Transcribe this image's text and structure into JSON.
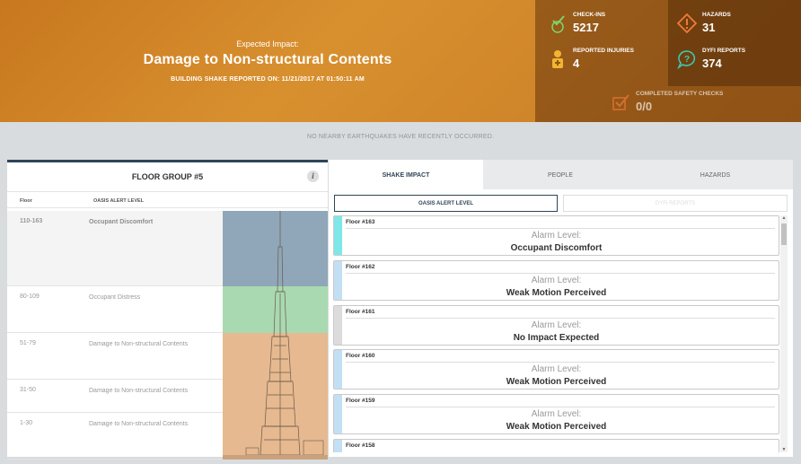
{
  "header": {
    "label": "Expected Impact:",
    "title": "Damage to Non-structural Contents",
    "subtitle": "BUILDING SHAKE REPORTED ON: 11/21/2017 AT 01:50:11 AM"
  },
  "stats": {
    "checkins": {
      "label": "CHECK-INS",
      "value": "5217",
      "icon": "checkin-icon"
    },
    "hazards": {
      "label": "HAZARDS",
      "value": "31",
      "icon": "warning-icon"
    },
    "injuries": {
      "label": "REPORTED INJURIES",
      "value": "4",
      "icon": "injury-icon"
    },
    "dyfi": {
      "label": "DYFI REPORTS",
      "value": "374",
      "icon": "question-chat-icon"
    },
    "safety": {
      "label": "COMPLETED SAFETY CHECKS",
      "value": "0/0",
      "icon": "checkbox-icon"
    }
  },
  "banner": "NO NEARBY EARTHQUAKES HAVE RECENTLY OCCURRED.",
  "left": {
    "title": "FLOOR GROUP #5",
    "info": "i",
    "col_floor": "Floor",
    "col_alert": "OASIS ALERT LEVEL",
    "rows": [
      {
        "floor": "110-163",
        "alert": "Occupant Discomfort",
        "color": "#8fa7b8"
      },
      {
        "floor": "80-109",
        "alert": "Occupant Distress",
        "color": "#a9d9b0"
      },
      {
        "floor": "51-79",
        "alert": "Damage to Non-structural Contents",
        "color": "#e6b990"
      },
      {
        "floor": "31-50",
        "alert": "Damage to Non-structural Contents",
        "color": "#e6b990"
      },
      {
        "floor": "1-30",
        "alert": "Damage to Non-structural Contents",
        "color": "#e6b990"
      }
    ]
  },
  "right": {
    "tabs": [
      "SHAKE IMPACT",
      "PEOPLE",
      "HAZARDS"
    ],
    "sub_tabs": [
      "OASIS ALERT LEVEL",
      "DYFI REPORTS"
    ],
    "alarm_label": "Alarm Level:",
    "cards": [
      {
        "floor": "Floor #163",
        "level": "Occupant Discomfort",
        "color": "#7fe7e8"
      },
      {
        "floor": "Floor #162",
        "level": "Weak Motion Perceived",
        "color": "#c3dff4"
      },
      {
        "floor": "Floor #161",
        "level": "No Impact Expected",
        "color": "#dcdcdc"
      },
      {
        "floor": "Floor #160",
        "level": "Weak Motion Perceived",
        "color": "#c3dff4"
      },
      {
        "floor": "Floor #159",
        "level": "Weak Motion Perceived",
        "color": "#c3dff4"
      },
      {
        "floor": "Floor #158",
        "level": "",
        "color": "#c3dff4"
      }
    ]
  }
}
